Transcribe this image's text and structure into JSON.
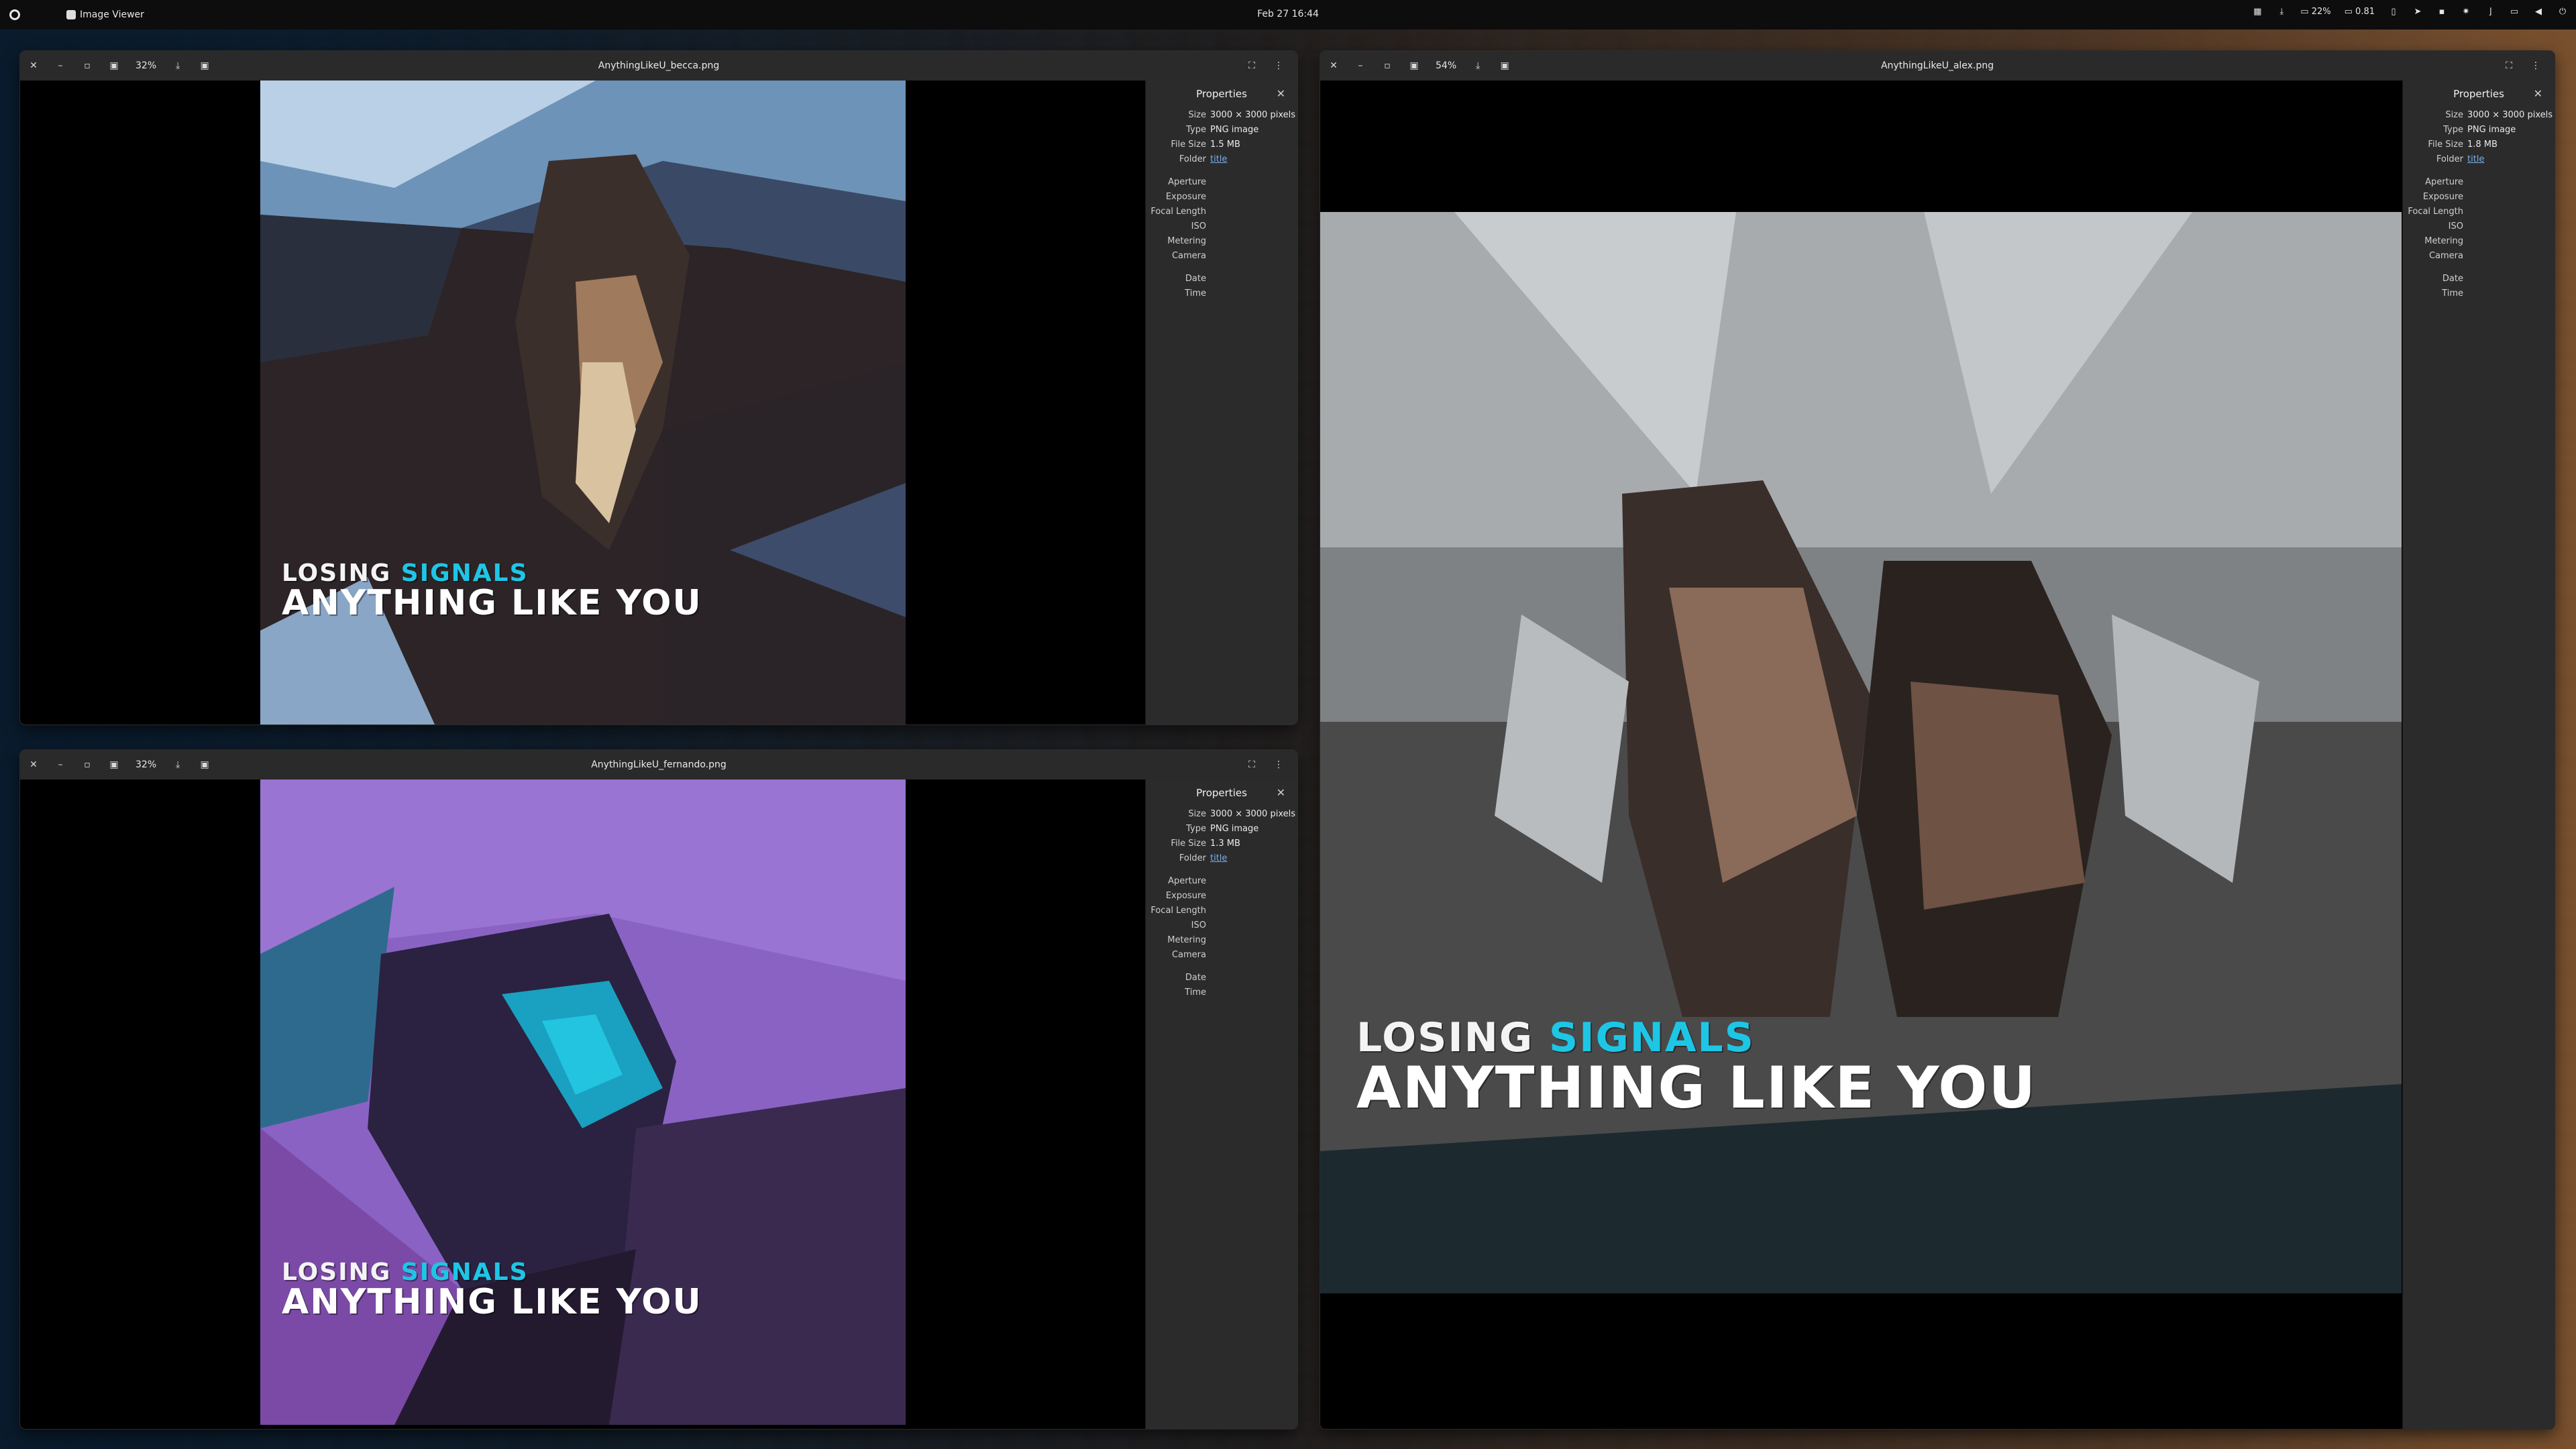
{
  "topbar": {
    "app_name": "Image Viewer",
    "clock": "Feb 27  16:44",
    "tray": {
      "cpu": "22%",
      "load": "0.81"
    }
  },
  "colors": {
    "accent": "#1ec6e6",
    "link": "#78aeed",
    "header": "#2a2a2a",
    "sidebar": "#2b2b2b"
  },
  "windows": [
    {
      "title": "AnythingLikeU_becca.png",
      "zoom": "32%",
      "properties": {
        "heading": "Properties",
        "size": "3000 × 3000 pixels",
        "type": "PNG image",
        "file_size": "1.5 MB",
        "folder": "title"
      },
      "poster": {
        "line1_a": "LOSING ",
        "line1_b": "SIGNALS",
        "line2": "ANYTHING LIKE YOU"
      }
    },
    {
      "title": "AnythingLikeU_fernando.png",
      "zoom": "32%",
      "properties": {
        "heading": "Properties",
        "size": "3000 × 3000 pixels",
        "type": "PNG image",
        "file_size": "1.3 MB",
        "folder": "title"
      },
      "poster": {
        "line1_a": "LOSING ",
        "line1_b": "SIGNALS",
        "line2": "ANYTHING LIKE YOU"
      }
    },
    {
      "title": "AnythingLikeU_alex.png",
      "zoom": "54%",
      "properties": {
        "heading": "Properties",
        "size": "3000 × 3000 pixels",
        "type": "PNG image",
        "file_size": "1.8 MB",
        "folder": "title"
      },
      "poster": {
        "line1_a": "LOSING ",
        "line1_b": "SIGNALS",
        "line2": "ANYTHING LIKE YOU"
      }
    }
  ],
  "property_labels": {
    "size": "Size",
    "type": "Type",
    "file_size": "File Size",
    "folder": "Folder",
    "aperture": "Aperture",
    "exposure": "Exposure",
    "focal_length": "Focal Length",
    "iso": "ISO",
    "metering": "Metering",
    "camera": "Camera",
    "date": "Date",
    "time": "Time"
  }
}
